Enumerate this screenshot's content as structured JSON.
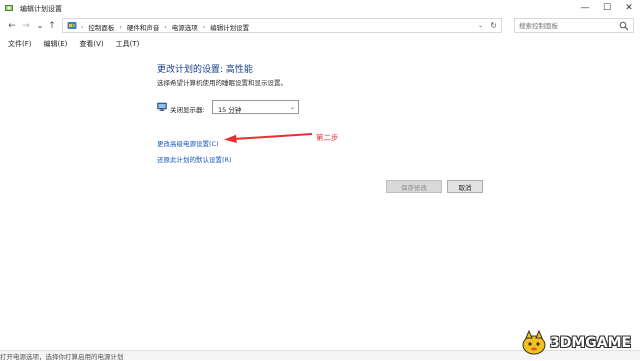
{
  "window": {
    "title": "编辑计划设置",
    "minimize_glyph": "—",
    "maximize_glyph": "☐",
    "close_glyph": "✕"
  },
  "nav": {
    "back_glyph": "←",
    "forward_glyph": "→",
    "recent_glyph": "⌄",
    "up_glyph": "↑"
  },
  "address": {
    "breadcrumbs": [
      "控制面板",
      "硬件和声音",
      "电源选项",
      "编辑计划设置"
    ],
    "separator": "›"
  },
  "search": {
    "placeholder": "搜索控制面板"
  },
  "menu": {
    "items": [
      "文件(F)",
      "编辑(E)",
      "查看(V)",
      "工具(T)"
    ]
  },
  "main": {
    "heading": "更改计划的设置: 高性能",
    "subtitle": "选择希望计算机使用的睡眠设置和显示设置。",
    "display_off_label": "关闭显示器:",
    "display_off_value": "15 分钟",
    "advanced_link": "更改高级电源设置(C)",
    "restore_link": "还原此计划的默认设置(R)",
    "annotation": "第二步",
    "save_button": "保存修改",
    "cancel_button": "取消"
  },
  "bottom_text": "打开电源选项，选择你打算启用的电源计划",
  "watermark": {
    "text": "3DMGAME"
  },
  "colors": {
    "heading": "#1a3e8c",
    "link": "#1656b8",
    "annotation": "#e53030"
  },
  "icons": {
    "title": "power-options-icon",
    "crumb": "control-panel-icon",
    "monitor": "monitor-icon",
    "search": "search-icon"
  }
}
